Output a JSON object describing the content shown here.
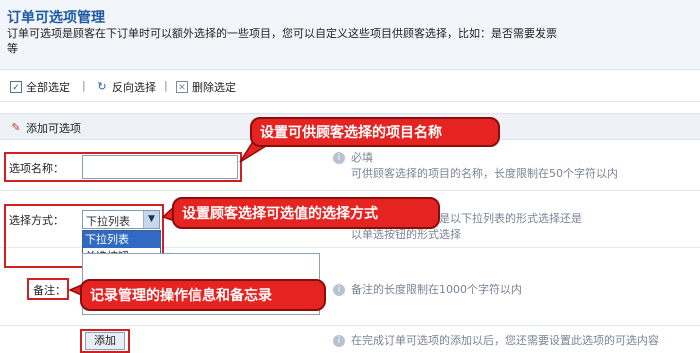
{
  "header": {
    "title": "订单可选项管理",
    "description": "订单可选项是顾客在下订单时可以额外选择的一些项目，您可以自定义这些项目供顾客选择，比如：是否需要发票等"
  },
  "toolbar": {
    "select_all": "全部选定",
    "invert": "反向选择",
    "delete": "删除选定",
    "separator": "|"
  },
  "section": {
    "label": "添加可选项"
  },
  "form": {
    "name_label": "选项名称：",
    "name_value": "",
    "method_label": "选择方式：",
    "method_value": "下拉列表",
    "method_options": [
      "下拉列表",
      "单选按钮"
    ],
    "note_label": "备注：",
    "note_value": "",
    "add_button": "添加"
  },
  "help": {
    "name_line1": "必填",
    "name_line2": "可供顾客选择的项目的名称，长度限制在50个字符以内",
    "method_line1": "选项的可选值时，是以下拉列表的形式选择还是",
    "method_line2": "以单选按钮的形式选择",
    "note": "备注的长度限制在1000个字符以内",
    "add": "在完成订单可选项的添加以后，您还需要设置此选项的可选内容"
  },
  "annotations": {
    "name": "设置可供顾客选择的项目名称",
    "method": "设置顾客选择可选值的选择方式",
    "note": "记录管理的操作信息和备忘录"
  },
  "colors": {
    "title_blue": "#1d5aa3",
    "callout_red": "#e52421",
    "highlight_border": "#d21f1f",
    "selected_option": "#316ac5"
  }
}
